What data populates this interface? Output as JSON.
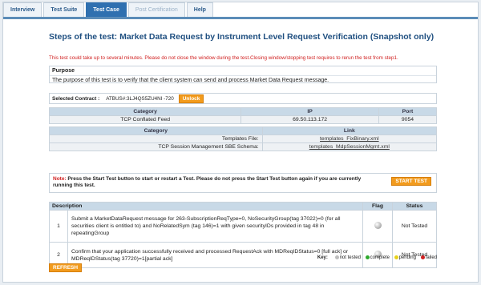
{
  "tabs": [
    {
      "label": "Interview"
    },
    {
      "label": "Test Suite"
    },
    {
      "label": "Test Case"
    },
    {
      "label": "Post Certification"
    },
    {
      "label": "Help"
    }
  ],
  "page": {
    "title": "Steps of the test: Market Data Request by Instrument Level Request Verification (Snapshot only)",
    "warning": "This test could take up to several minutes. Please do not close the window during the test.Closing window/stopping test requires to rerun the test from step1."
  },
  "purpose": {
    "heading": "Purpose",
    "text": "The purpose of this test is to verify that the client system can send and process Market Data Request message."
  },
  "contract": {
    "label": "Selected Contract :",
    "value": "ATBUS#:3LJ4QS5ZU4NI -720",
    "unlock_label": "Unlock"
  },
  "feed_table": {
    "headers": [
      "Category",
      "IP",
      "Port"
    ],
    "row": [
      "TCP Conflated Feed",
      "69.50.113.172",
      "9054"
    ]
  },
  "links_table": {
    "headers": [
      "Category",
      "Link"
    ],
    "rows": [
      [
        "Templates File:",
        "templates_FixBinary.xml"
      ],
      [
        "TCP Session Management SBE Schema:",
        "templates_MdpSessionMgmt.xml"
      ]
    ]
  },
  "note": {
    "prefix": "Note:",
    "text": " Press the Start Test button to start or restart a Test. Please do not press the Start Test button again if you are currently running this test.",
    "start_label": "START TEST"
  },
  "steps": {
    "headers": [
      "Description",
      "Flag",
      "Status"
    ],
    "rows": [
      {
        "num": "1",
        "desc": "Submit a MarketDataRequest message for 263-SubscriptionReqType=0, NoSecurityGroup(tag 37022)=0 (for all securities client is entitled to) and NoRelatedSym (tag 146)=1 with given securityIDs provided in tag 48 in repeatingGroup",
        "status": "Not Tested"
      },
      {
        "num": "2",
        "desc": "Confirm that your application successfully received and processed RequestAck with MDReqIDStatus=0 [full ack] or MDReqIDStatus(tag 37720)=1[partial ack]",
        "status": "Not Tested"
      }
    ]
  },
  "key": {
    "label": "Key:",
    "items": [
      {
        "label": "not tested",
        "color": "#bdbdbd"
      },
      {
        "label": "complete",
        "color": "#2eaa2e"
      },
      {
        "label": "pending",
        "color": "#e8d21a"
      },
      {
        "label": "failed",
        "color": "#d02020"
      }
    ]
  },
  "refresh_label": "REFRESH"
}
